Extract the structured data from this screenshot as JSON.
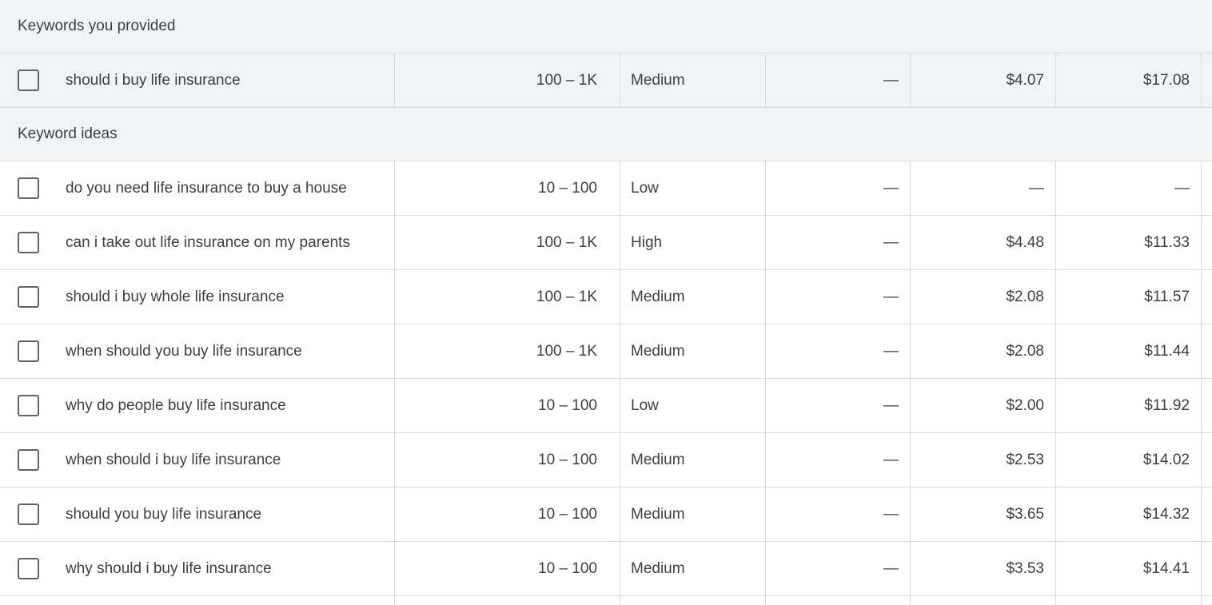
{
  "sections": {
    "provided": {
      "title": "Keywords you provided",
      "rows": [
        {
          "keyword": "should i buy life insurance",
          "volume": "100 – 1K",
          "competition": "Medium",
          "share": "—",
          "bid_low": "$4.07",
          "bid_high": "$17.08"
        }
      ]
    },
    "ideas": {
      "title": "Keyword ideas",
      "rows": [
        {
          "keyword": "do you need life insurance to buy a house",
          "volume": "10 – 100",
          "competition": "Low",
          "share": "—",
          "bid_low": "—",
          "bid_high": "—"
        },
        {
          "keyword": "can i take out life insurance on my parents",
          "volume": "100 – 1K",
          "competition": "High",
          "share": "—",
          "bid_low": "$4.48",
          "bid_high": "$11.33"
        },
        {
          "keyword": "should i buy whole life insurance",
          "volume": "100 – 1K",
          "competition": "Medium",
          "share": "—",
          "bid_low": "$2.08",
          "bid_high": "$11.57"
        },
        {
          "keyword": "when should you buy life insurance",
          "volume": "100 – 1K",
          "competition": "Medium",
          "share": "—",
          "bid_low": "$2.08",
          "bid_high": "$11.44"
        },
        {
          "keyword": "why do people buy life insurance",
          "volume": "10 – 100",
          "competition": "Low",
          "share": "—",
          "bid_low": "$2.00",
          "bid_high": "$11.92"
        },
        {
          "keyword": "when should i buy life insurance",
          "volume": "10 – 100",
          "competition": "Medium",
          "share": "—",
          "bid_low": "$2.53",
          "bid_high": "$14.02"
        },
        {
          "keyword": "should you buy life insurance",
          "volume": "10 – 100",
          "competition": "Medium",
          "share": "—",
          "bid_low": "$3.65",
          "bid_high": "$14.32"
        },
        {
          "keyword": "why should i buy life insurance",
          "volume": "10 – 100",
          "competition": "Medium",
          "share": "—",
          "bid_low": "$3.53",
          "bid_high": "$14.41"
        }
      ]
    }
  }
}
